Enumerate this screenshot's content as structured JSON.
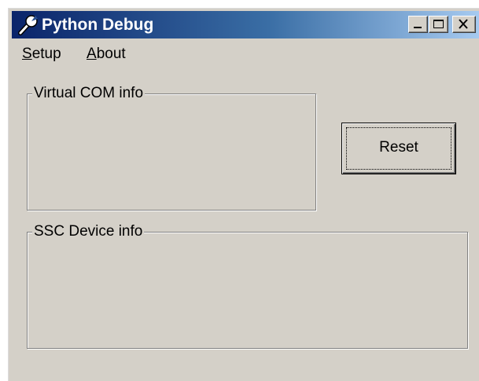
{
  "window": {
    "title": "Python Debug",
    "icon": "wrench-icon",
    "controls": {
      "minimize_icon": "minimize-icon",
      "maximize_icon": "maximize-icon",
      "close_icon": "close-icon"
    }
  },
  "menubar": {
    "items": [
      {
        "mnemonic": "S",
        "rest": "etup"
      },
      {
        "mnemonic": "A",
        "rest": "bout"
      }
    ]
  },
  "groups": {
    "virtual_com": {
      "label": "Virtual COM info"
    },
    "ssc_device": {
      "label": "SSC Device info"
    }
  },
  "buttons": {
    "reset_label": "Reset"
  },
  "colors": {
    "titlebar_start": "#0a246a",
    "titlebar_end": "#a6caf0",
    "face": "#d4d0c8"
  }
}
